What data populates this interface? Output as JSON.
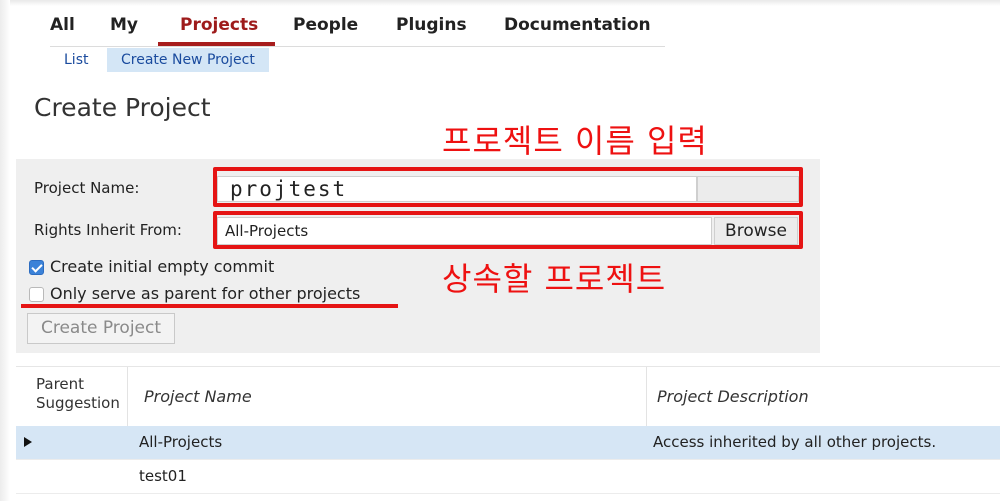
{
  "menu": {
    "items": [
      "All",
      "My",
      "Projects",
      "People",
      "Plugins",
      "Documentation"
    ],
    "active": "Projects"
  },
  "submenu": {
    "list": "List",
    "create_new": "Create New Project"
  },
  "page_title": "Create Project",
  "annotations": {
    "name_hint": "프로젝트 이름 입력",
    "parent_hint": "상속할 프로젝트"
  },
  "form": {
    "project_name_label": "Project Name:",
    "project_name_value": "projtest",
    "rights_label": "Rights Inherit From:",
    "rights_value": "All-Projects",
    "browse_label": "Browse",
    "initial_commit_label": "Create initial empty commit",
    "initial_commit_checked": true,
    "parent_only_label": "Only serve as parent for other projects",
    "parent_only_checked": false,
    "create_button": "Create Project"
  },
  "table": {
    "headers": {
      "suggestion_line1": "Parent",
      "suggestion_line2": "Suggestion",
      "name": "Project Name",
      "description": "Project Description"
    },
    "rows": [
      {
        "name": "All-Projects",
        "description": "Access inherited by all other projects.",
        "selected": true
      },
      {
        "name": "test01",
        "description": "",
        "selected": false
      }
    ]
  },
  "colors": {
    "accent": "#a71d1d",
    "annotation": "#e51414",
    "link": "#1a4b9e",
    "selected_row": "#d6e6f5"
  }
}
